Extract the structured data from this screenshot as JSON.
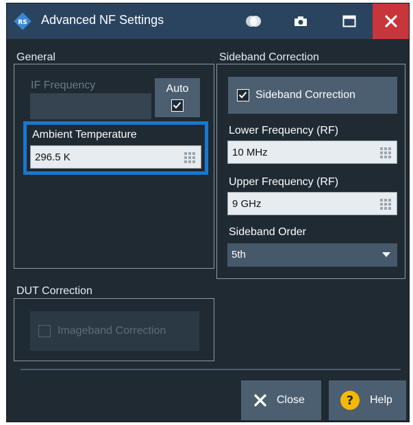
{
  "window": {
    "title": "Advanced NF Settings",
    "title_icons": [
      "rs-logo-icon",
      "toggle-theme-icon",
      "camera-icon",
      "maximize-icon",
      "close-icon"
    ],
    "colors": {
      "titlebar": "#2a4460",
      "close": "#c8353a",
      "body": "#1f2a33",
      "focus": "#1878d0"
    }
  },
  "general": {
    "group_label": "General",
    "if_frequency": {
      "label": "IF Frequency",
      "value": "",
      "enabled": false
    },
    "auto": {
      "label": "Auto",
      "checked": true
    },
    "ambient_temperature": {
      "label": "Ambient Temperature",
      "value": "296.5 K"
    }
  },
  "sideband": {
    "group_label": "Sideband Correction",
    "toggle": {
      "label": "Sideband Correction",
      "checked": true
    },
    "lower_frequency": {
      "label": "Lower Frequency (RF)",
      "value": "10 MHz"
    },
    "upper_frequency": {
      "label": "Upper Frequency (RF)",
      "value": "9 GHz"
    },
    "order": {
      "label": "Sideband Order",
      "value": "5th"
    }
  },
  "dut": {
    "group_label": "DUT Correction",
    "imageband": {
      "label": "Imageband Correction",
      "checked": false,
      "enabled": false
    }
  },
  "footer": {
    "close_label": "Close",
    "help_label": "Help"
  }
}
